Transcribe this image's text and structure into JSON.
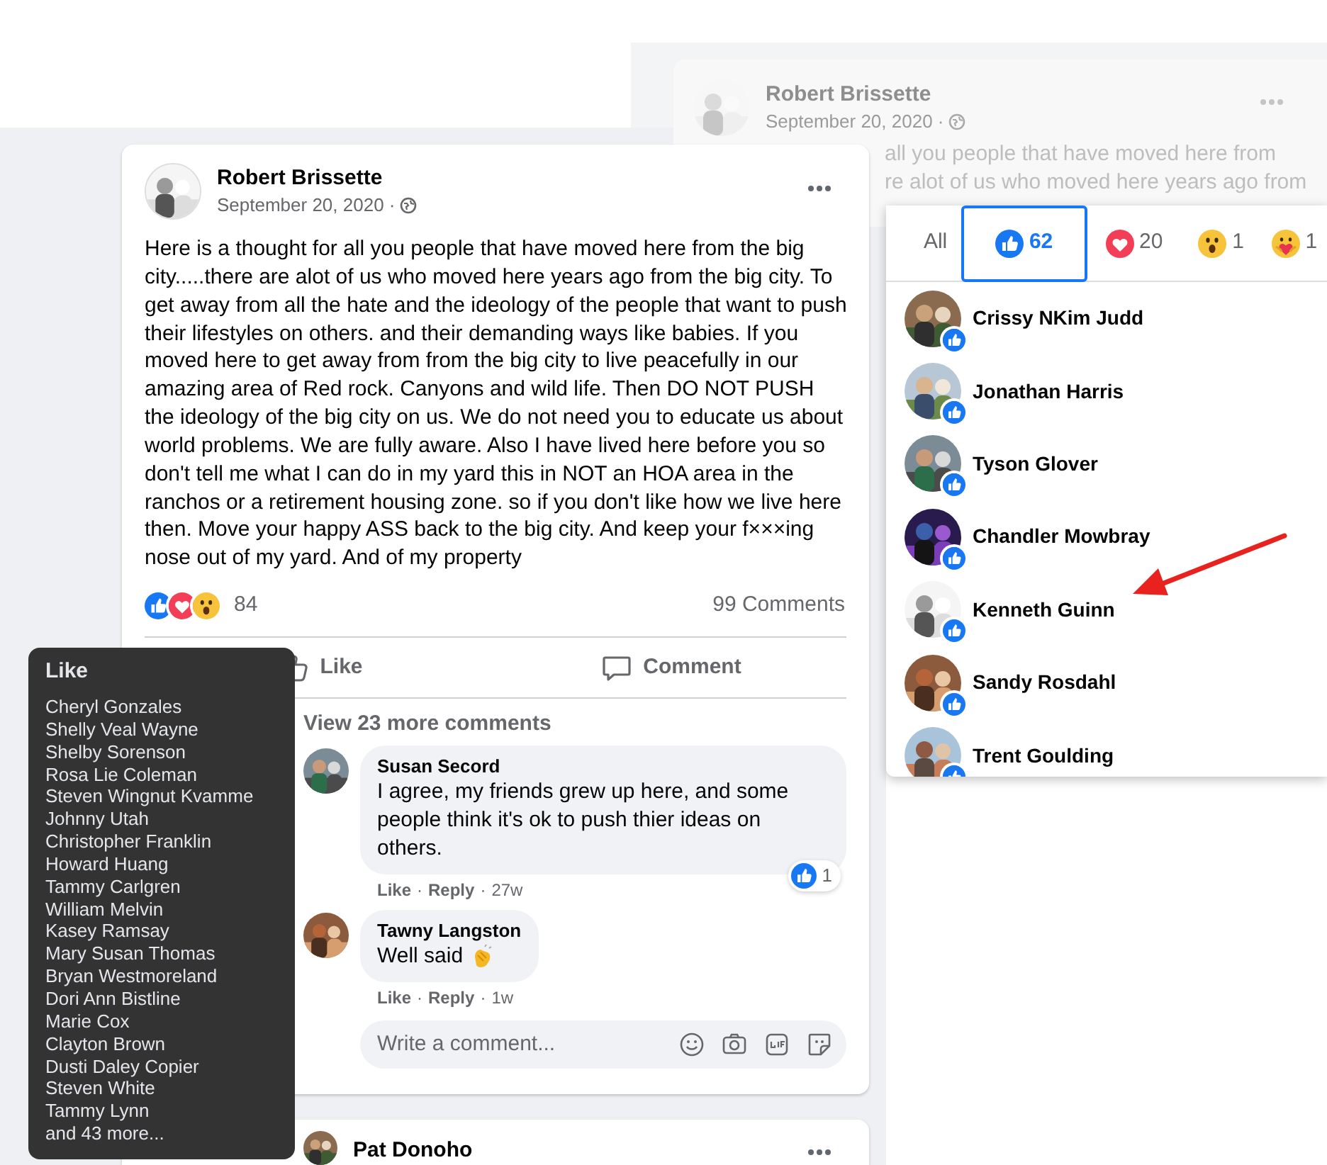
{
  "background_post": {
    "author": "Robert Brissette",
    "date": "September 20, 2020 ·",
    "text_lines": [
      "all you people that have moved here from",
      "re alot of us who moved here years ago from"
    ]
  },
  "post": {
    "author": "Robert Brissette",
    "date": "September 20, 2020 ·",
    "text": "Here is a thought for all you people that have moved here from the big city.....there are alot of us who moved here years ago from the big city. To get away from all the hate and the ideology of the people that want to push their lifestyles on others. and their demanding ways like babies. If you moved here to get away from from the big city to live peacefully in our amazing area of Red rock. Canyons and wild life. Then DO NOT PUSH the ideology of the big city on us. We do not need you to educate us about world problems. We are fully aware. Also I have lived here before you so don't tell me what I can do in my yard this in NOT an HOA area in the ranchos or a retirement housing zone. so if you don't like how we live here then. Move your happy ASS back to the big city. And keep your f×××ing nose out of my yard. And of my property",
    "reactions": [
      {
        "kind": "like"
      },
      {
        "kind": "love"
      },
      {
        "kind": "wow"
      }
    ],
    "reaction_count": "84",
    "comment_count": "99 Comments",
    "actions": [
      {
        "kind": "like",
        "label": "Like"
      },
      {
        "kind": "comment",
        "label": "Comment"
      }
    ],
    "more_comments": "View 23 more comments",
    "comments": [
      {
        "author": "Susan Secord",
        "text": "I agree, my friends grew up here, and some people think it's ok to push thier ideas on others.",
        "emoji": false,
        "actions": [
          "Like",
          "Reply"
        ],
        "separator": "·",
        "time": "27w",
        "reaction_count": "1"
      },
      {
        "author": "Tawny Langston",
        "text": "Well said",
        "emoji": true,
        "actions": [
          "Like",
          "Reply"
        ],
        "separator": "·",
        "time": "1w"
      }
    ],
    "comment_box": {
      "placeholder": "Write a comment..."
    }
  },
  "next_post": {
    "author": "Pat Donoho"
  },
  "reactions_panel": {
    "tabs": [
      {
        "kind": "all",
        "label": "All",
        "selected": false
      },
      {
        "kind": "like",
        "label": "62",
        "selected": true
      },
      {
        "kind": "love",
        "label": "20",
        "selected": false
      },
      {
        "kind": "wow",
        "label": "1",
        "selected": false
      },
      {
        "kind": "care",
        "label": "1",
        "selected": false
      }
    ],
    "people": [
      {
        "name": "Crissy NKim Judd"
      },
      {
        "name": "Jonathan Harris"
      },
      {
        "name": "Tyson Glover"
      },
      {
        "name": "Chandler Mowbray"
      },
      {
        "name": "Kenneth Guinn"
      },
      {
        "name": "Sandy Rosdahl"
      },
      {
        "name": "Trent Goulding"
      }
    ]
  },
  "tooltip": {
    "title": "Like",
    "names": [
      "Cheryl Gonzales",
      "Shelly Veal Wayne",
      "Shelby Sorenson",
      "Rosa Lie Coleman",
      "Steven Wingnut Kvamme",
      "Johnny Utah",
      "Christopher Franklin",
      "Howard Huang",
      "Tammy Carlgren",
      "William Melvin",
      "Kasey Ramsay",
      "Mary Susan Thomas",
      "Bryan Westmoreland",
      "Dori Ann Bistline",
      "Marie Cox",
      "Clayton Brown",
      "Dusti Daley Copier",
      "Steven White",
      "Tammy Lynn"
    ],
    "more": "and 43 more..."
  }
}
